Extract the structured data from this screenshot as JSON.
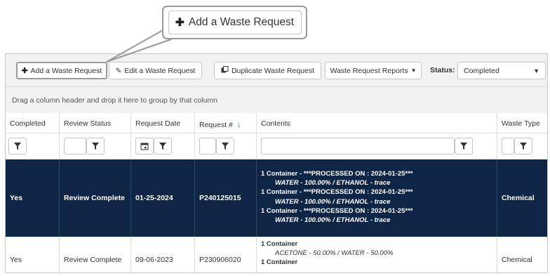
{
  "callout": {
    "label": "Add a Waste Request"
  },
  "toolbar": {
    "add_label": "Add a Waste Request",
    "edit_label": "Edit a Waste Request",
    "duplicate_label": "Duplicate Waste Request",
    "reports_label": "Waste Request Reports",
    "status_label": "Status:",
    "status_value": "Completed"
  },
  "group_hint": "Drag a column header and drop it here to group by that column",
  "columns": {
    "completed": "Completed",
    "review_status": "Review Status",
    "request_date": "Request Date",
    "request_no": "Request #",
    "contents": "Contents",
    "waste_type": "Waste Type"
  },
  "rows": [
    {
      "completed": "Yes",
      "review_status": "Review Complete",
      "request_date": "01-25-2024",
      "request_no": "P240125015",
      "contents": [
        "1 Container - ***PROCESSED ON : 2024-01-25***",
        "WATER - 100.00% / ETHANOL - trace",
        "1 Container - ***PROCESSED ON : 2024-01-25***",
        "WATER - 100.00% / ETHANOL - trace",
        "1 Container - ***PROCESSED ON : 2024-01-25***",
        "WATER - 100.00% / ETHANOL - trace"
      ],
      "waste_type": "Chemical"
    },
    {
      "completed": "Yes",
      "review_status": "Review Complete",
      "request_date": "09-06-2023",
      "request_no": "P230906020",
      "contents": [
        "1 Container",
        "ACETONE - 50.00% / WATER - 50.00%",
        "1 Container"
      ],
      "waste_type": "Chemical"
    }
  ],
  "colors": {
    "selected_row": "#0e2546",
    "toolbar_bg": "#f2f2f2",
    "sort_arrow": "#3a7bd5"
  },
  "icons": {
    "plus": "plus-icon",
    "edit": "pencil-icon",
    "duplicate": "copy-icon",
    "filter": "filter-icon",
    "calendar": "calendar-icon",
    "caret": "caret-down-icon"
  }
}
